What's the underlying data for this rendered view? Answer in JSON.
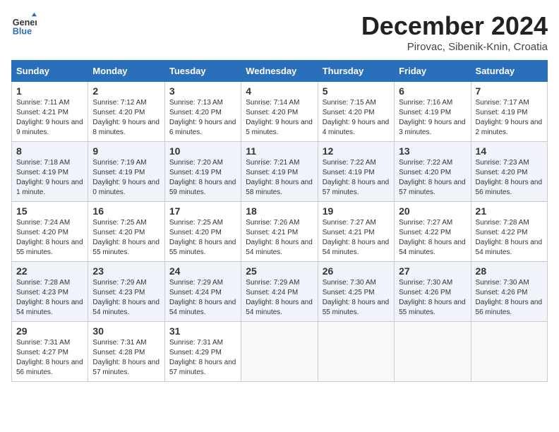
{
  "header": {
    "logo_line1": "General",
    "logo_line2": "Blue",
    "month": "December 2024",
    "location": "Pirovac, Sibenik-Knin, Croatia"
  },
  "days_of_week": [
    "Sunday",
    "Monday",
    "Tuesday",
    "Wednesday",
    "Thursday",
    "Friday",
    "Saturday"
  ],
  "weeks": [
    [
      {
        "day": 1,
        "sunrise": "7:11 AM",
        "sunset": "4:21 PM",
        "daylight": "9 hours and 9 minutes."
      },
      {
        "day": 2,
        "sunrise": "7:12 AM",
        "sunset": "4:20 PM",
        "daylight": "9 hours and 8 minutes."
      },
      {
        "day": 3,
        "sunrise": "7:13 AM",
        "sunset": "4:20 PM",
        "daylight": "9 hours and 6 minutes."
      },
      {
        "day": 4,
        "sunrise": "7:14 AM",
        "sunset": "4:20 PM",
        "daylight": "9 hours and 5 minutes."
      },
      {
        "day": 5,
        "sunrise": "7:15 AM",
        "sunset": "4:20 PM",
        "daylight": "9 hours and 4 minutes."
      },
      {
        "day": 6,
        "sunrise": "7:16 AM",
        "sunset": "4:19 PM",
        "daylight": "9 hours and 3 minutes."
      },
      {
        "day": 7,
        "sunrise": "7:17 AM",
        "sunset": "4:19 PM",
        "daylight": "9 hours and 2 minutes."
      }
    ],
    [
      {
        "day": 8,
        "sunrise": "7:18 AM",
        "sunset": "4:19 PM",
        "daylight": "9 hours and 1 minute."
      },
      {
        "day": 9,
        "sunrise": "7:19 AM",
        "sunset": "4:19 PM",
        "daylight": "9 hours and 0 minutes."
      },
      {
        "day": 10,
        "sunrise": "7:20 AM",
        "sunset": "4:19 PM",
        "daylight": "8 hours and 59 minutes."
      },
      {
        "day": 11,
        "sunrise": "7:21 AM",
        "sunset": "4:19 PM",
        "daylight": "8 hours and 58 minutes."
      },
      {
        "day": 12,
        "sunrise": "7:22 AM",
        "sunset": "4:19 PM",
        "daylight": "8 hours and 57 minutes."
      },
      {
        "day": 13,
        "sunrise": "7:22 AM",
        "sunset": "4:20 PM",
        "daylight": "8 hours and 57 minutes."
      },
      {
        "day": 14,
        "sunrise": "7:23 AM",
        "sunset": "4:20 PM",
        "daylight": "8 hours and 56 minutes."
      }
    ],
    [
      {
        "day": 15,
        "sunrise": "7:24 AM",
        "sunset": "4:20 PM",
        "daylight": "8 hours and 55 minutes."
      },
      {
        "day": 16,
        "sunrise": "7:25 AM",
        "sunset": "4:20 PM",
        "daylight": "8 hours and 55 minutes."
      },
      {
        "day": 17,
        "sunrise": "7:25 AM",
        "sunset": "4:20 PM",
        "daylight": "8 hours and 55 minutes."
      },
      {
        "day": 18,
        "sunrise": "7:26 AM",
        "sunset": "4:21 PM",
        "daylight": "8 hours and 54 minutes."
      },
      {
        "day": 19,
        "sunrise": "7:27 AM",
        "sunset": "4:21 PM",
        "daylight": "8 hours and 54 minutes."
      },
      {
        "day": 20,
        "sunrise": "7:27 AM",
        "sunset": "4:22 PM",
        "daylight": "8 hours and 54 minutes."
      },
      {
        "day": 21,
        "sunrise": "7:28 AM",
        "sunset": "4:22 PM",
        "daylight": "8 hours and 54 minutes."
      }
    ],
    [
      {
        "day": 22,
        "sunrise": "7:28 AM",
        "sunset": "4:23 PM",
        "daylight": "8 hours and 54 minutes."
      },
      {
        "day": 23,
        "sunrise": "7:29 AM",
        "sunset": "4:23 PM",
        "daylight": "8 hours and 54 minutes."
      },
      {
        "day": 24,
        "sunrise": "7:29 AM",
        "sunset": "4:24 PM",
        "daylight": "8 hours and 54 minutes."
      },
      {
        "day": 25,
        "sunrise": "7:29 AM",
        "sunset": "4:24 PM",
        "daylight": "8 hours and 54 minutes."
      },
      {
        "day": 26,
        "sunrise": "7:30 AM",
        "sunset": "4:25 PM",
        "daylight": "8 hours and 55 minutes."
      },
      {
        "day": 27,
        "sunrise": "7:30 AM",
        "sunset": "4:26 PM",
        "daylight": "8 hours and 55 minutes."
      },
      {
        "day": 28,
        "sunrise": "7:30 AM",
        "sunset": "4:26 PM",
        "daylight": "8 hours and 56 minutes."
      }
    ],
    [
      {
        "day": 29,
        "sunrise": "7:31 AM",
        "sunset": "4:27 PM",
        "daylight": "8 hours and 56 minutes."
      },
      {
        "day": 30,
        "sunrise": "7:31 AM",
        "sunset": "4:28 PM",
        "daylight": "8 hours and 57 minutes."
      },
      {
        "day": 31,
        "sunrise": "7:31 AM",
        "sunset": "4:29 PM",
        "daylight": "8 hours and 57 minutes."
      },
      null,
      null,
      null,
      null
    ]
  ]
}
